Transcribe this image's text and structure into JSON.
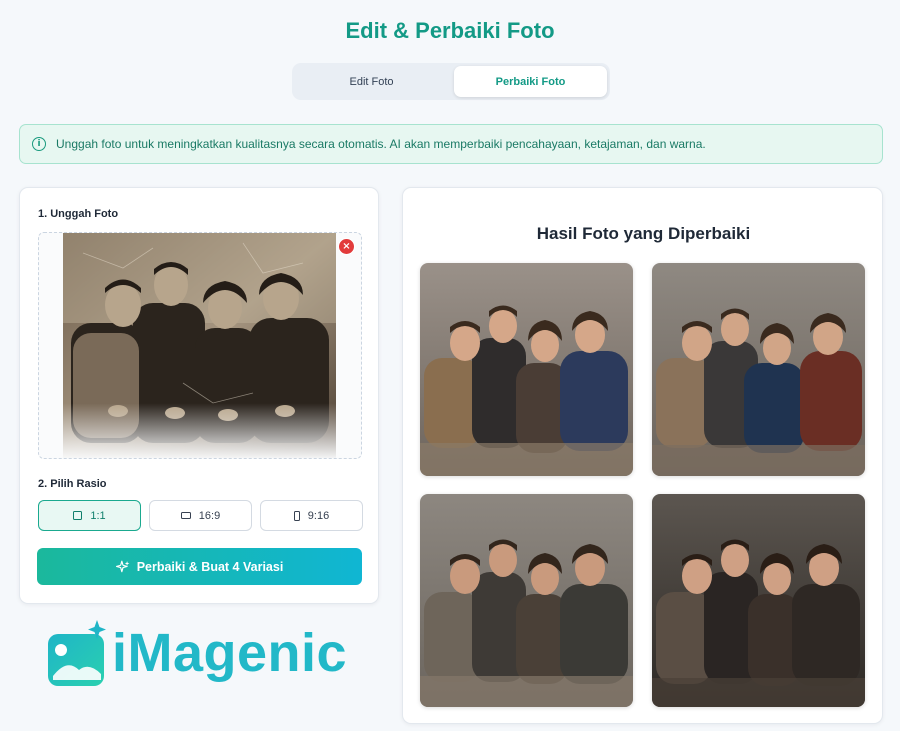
{
  "header": {
    "title": "Edit & Perbaiki Foto"
  },
  "tabs": [
    {
      "label": "Edit Foto",
      "active": false
    },
    {
      "label": "Perbaiki Foto",
      "active": true
    }
  ],
  "info": {
    "icon": "info-icon",
    "text": "Unggah foto untuk meningkatkan kualitasnya secara otomatis. AI akan memperbaiki pencahayaan, ketajaman, dan warna."
  },
  "upload": {
    "label": "1. Unggah Foto",
    "remove_icon": "close-icon"
  },
  "ratio": {
    "label": "2. Pilih Rasio",
    "options": [
      {
        "label": "1:1",
        "icon": "square-icon",
        "active": true
      },
      {
        "label": "16:9",
        "icon": "landscape-icon",
        "active": false
      },
      {
        "label": "9:16",
        "icon": "portrait-icon",
        "active": false
      }
    ]
  },
  "action": {
    "label": "Perbaiki & Buat 4 Variasi",
    "icon": "sparkle-icon"
  },
  "brand": {
    "name": "iMagenic",
    "color": "#22b8c8"
  },
  "results": {
    "title": "Hasil Foto yang Diperbaiki",
    "count": 4
  },
  "colors": {
    "accent": "#139a86",
    "button_start": "#1bb89c",
    "button_end": "#10b6d3",
    "danger": "#e23b3b"
  }
}
